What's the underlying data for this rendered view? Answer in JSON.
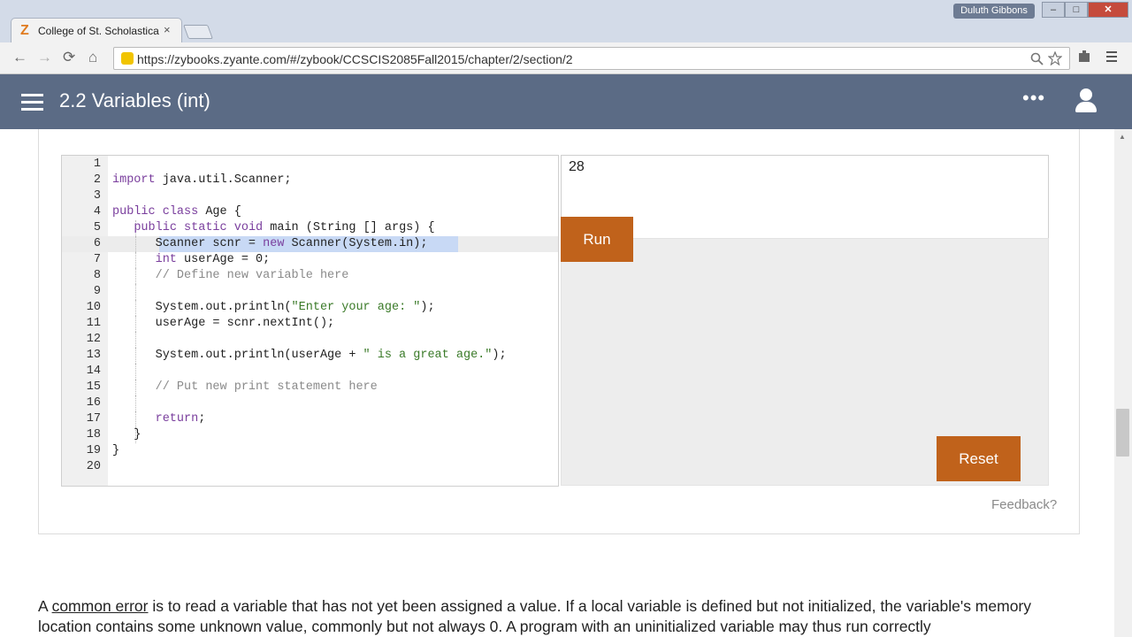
{
  "browser": {
    "tab_icon": "Z",
    "tab_title": "College of St. Scholastica",
    "tab_close": "×",
    "user_chip": "Duluth Gibbons",
    "url": "https://zybooks.zyante.com/#/zybook/CCSCIS2085Fall2015/chapter/2/section/2",
    "nav": {
      "back": "←",
      "forward": "→",
      "reload": "⟳",
      "home": "⌂"
    },
    "window": {
      "minimize": "‒",
      "maximize": "□",
      "close": "✕"
    }
  },
  "app": {
    "title": "2.2 Variables (int)",
    "more": "•••"
  },
  "editor": {
    "active_line": 6,
    "lines": [
      {
        "n": "1",
        "code": ""
      },
      {
        "n": "2",
        "code": "import java.util.Scanner;"
      },
      {
        "n": "3",
        "code": ""
      },
      {
        "n": "4",
        "code": "public class Age {"
      },
      {
        "n": "5",
        "code": "   public static void main (String [] args) {"
      },
      {
        "n": "6",
        "code": "      Scanner scnr = new Scanner(System.in);"
      },
      {
        "n": "7",
        "code": "      int userAge = 0;"
      },
      {
        "n": "8",
        "code": "      // Define new variable here"
      },
      {
        "n": "9",
        "code": ""
      },
      {
        "n": "10",
        "code": "      System.out.println(\"Enter your age: \");"
      },
      {
        "n": "11",
        "code": "      userAge = scnr.nextInt();"
      },
      {
        "n": "12",
        "code": ""
      },
      {
        "n": "13",
        "code": "      System.out.println(userAge + \" is a great age.\");"
      },
      {
        "n": "14",
        "code": ""
      },
      {
        "n": "15",
        "code": "      // Put new print statement here"
      },
      {
        "n": "16",
        "code": ""
      },
      {
        "n": "17",
        "code": "      return;"
      },
      {
        "n": "18",
        "code": "   }"
      },
      {
        "n": "19",
        "code": "}"
      },
      {
        "n": "20",
        "code": ""
      }
    ]
  },
  "output": {
    "value": "28"
  },
  "buttons": {
    "run": "Run",
    "reset": "Reset"
  },
  "feedback": "Feedback?",
  "paragraph": {
    "lead": "A ",
    "term": "common error",
    "rest": " is to read a variable that has not yet been assigned a value. If a local variable is defined but not initialized, the variable's memory location contains some unknown value, commonly but not always 0. A program with an uninitialized variable may thus run correctly"
  },
  "colors": {
    "appbar": "#5b6b85",
    "button": "#c0621b"
  }
}
